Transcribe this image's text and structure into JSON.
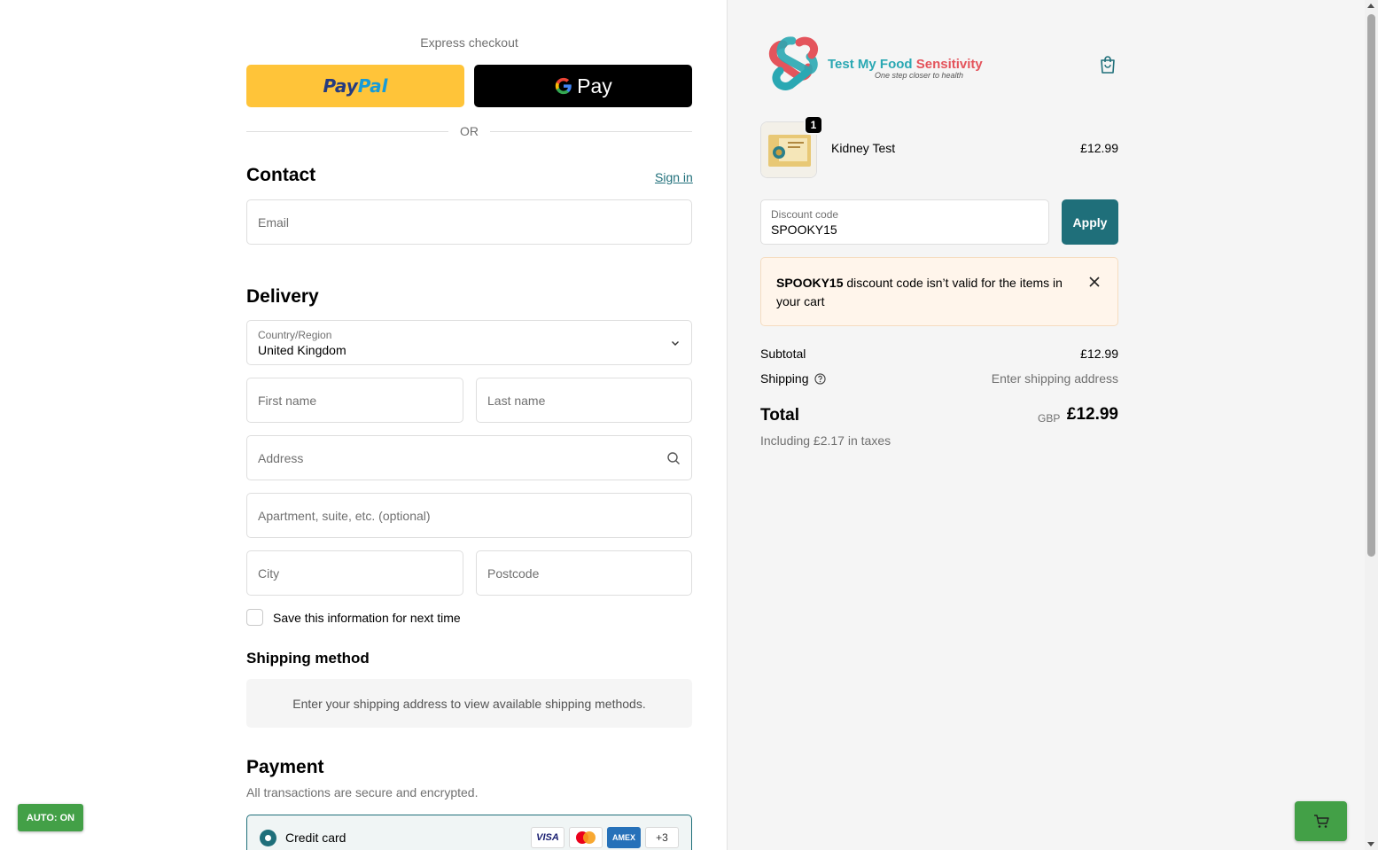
{
  "express": {
    "title": "Express checkout",
    "paypal_part1": "Pay",
    "paypal_part2": "Pal",
    "gpay_label": "Pay",
    "or_label": "OR"
  },
  "contact": {
    "heading": "Contact",
    "signin_label": "Sign in",
    "email_placeholder": "Email"
  },
  "delivery": {
    "heading": "Delivery",
    "country_label": "Country/Region",
    "country_value": "United Kingdom",
    "first_name_placeholder": "First name",
    "last_name_placeholder": "Last name",
    "address_placeholder": "Address",
    "apartment_placeholder": "Apartment, suite, etc. (optional)",
    "city_placeholder": "City",
    "postcode_placeholder": "Postcode",
    "save_info_label": "Save this information for next time"
  },
  "shipping_method": {
    "heading": "Shipping method",
    "notice": "Enter your shipping address to view available shipping methods."
  },
  "payment": {
    "heading": "Payment",
    "subtitle": "All transactions are secure and encrypted.",
    "credit_card_label": "Credit card",
    "card_visa": "VISA",
    "card_amex": "AMEX",
    "card_more": "+3"
  },
  "auto_badge": "AUTO: ON",
  "brand": {
    "name_part1": "Test My Food ",
    "name_part2": "Sensitivity",
    "tagline": "One step closer to health",
    "accent_teal": "#2aa8b3",
    "accent_red": "#e4545c"
  },
  "order": {
    "quantity": "1",
    "product_name": "Kidney Test",
    "product_price": "£12.99"
  },
  "discount": {
    "label": "Discount code",
    "value": "SPOOKY15",
    "apply_label": "Apply",
    "error_code": "SPOOKY15",
    "error_message": " discount code isn’t valid for the items in your cart"
  },
  "summary": {
    "subtotal_label": "Subtotal",
    "subtotal_value": "£12.99",
    "shipping_label": "Shipping",
    "shipping_value": "Enter shipping address",
    "total_label": "Total",
    "currency": "GBP",
    "total_value": "£12.99",
    "tax_note": "Including £2.17 in taxes"
  },
  "colors": {
    "primary": "#1f6f7a",
    "paypal_yellow": "#ffc439",
    "auto_green": "#43a047",
    "warning_bg": "#fff5eb"
  }
}
